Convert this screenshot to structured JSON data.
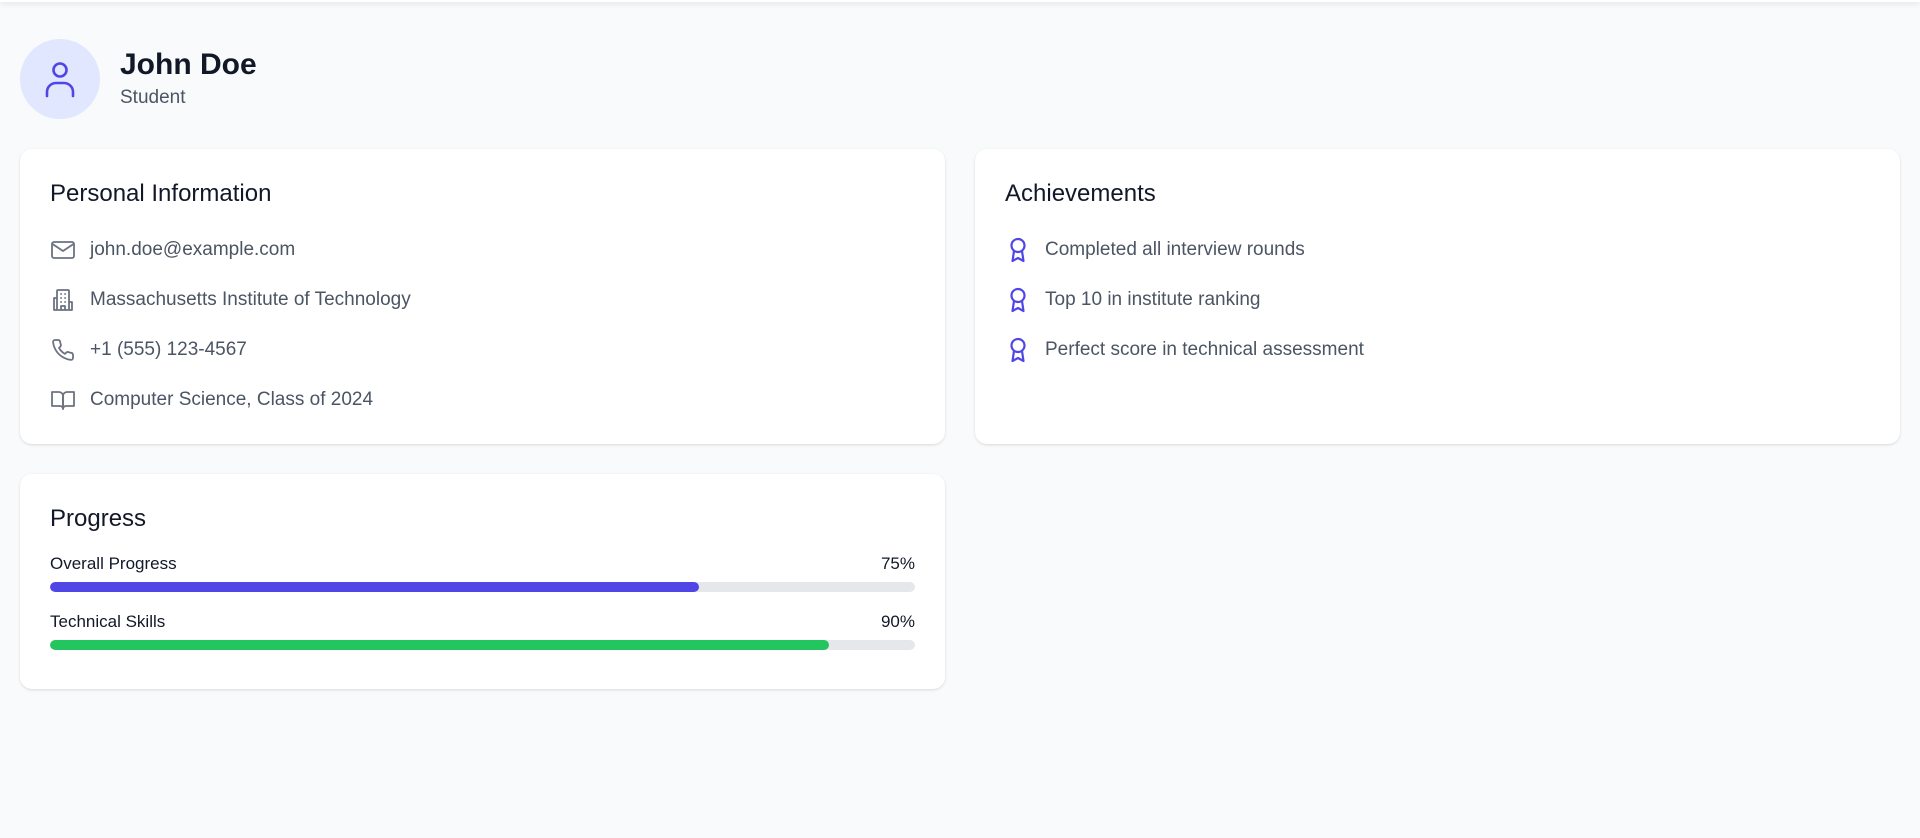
{
  "profile": {
    "name": "John Doe",
    "role": "Student",
    "avatar_icon": "user-icon"
  },
  "personal_info": {
    "title": "Personal Information",
    "items": [
      {
        "icon": "mail-icon",
        "text": "john.doe@example.com"
      },
      {
        "icon": "building-icon",
        "text": "Massachusetts Institute of Technology"
      },
      {
        "icon": "phone-icon",
        "text": "+1 (555) 123-4567"
      },
      {
        "icon": "book-icon",
        "text": "Computer Science, Class of 2024"
      }
    ]
  },
  "achievements": {
    "title": "Achievements",
    "items": [
      {
        "icon": "award-icon",
        "text": "Completed all interview rounds"
      },
      {
        "icon": "award-icon",
        "text": "Top 10 in institute ranking"
      },
      {
        "icon": "award-icon",
        "text": "Perfect score in technical assessment"
      }
    ]
  },
  "progress": {
    "title": "Progress",
    "items": [
      {
        "label": "Overall Progress",
        "value_text": "75%",
        "value": 75,
        "color": "#4f46e5"
      },
      {
        "label": "Technical Skills",
        "value_text": "90%",
        "value": 90,
        "color": "#22c55e"
      }
    ]
  },
  "colors": {
    "accent": "#4f46e5",
    "avatar_bg": "#e0e7ff",
    "success": "#22c55e",
    "background": "#f9fafb"
  }
}
